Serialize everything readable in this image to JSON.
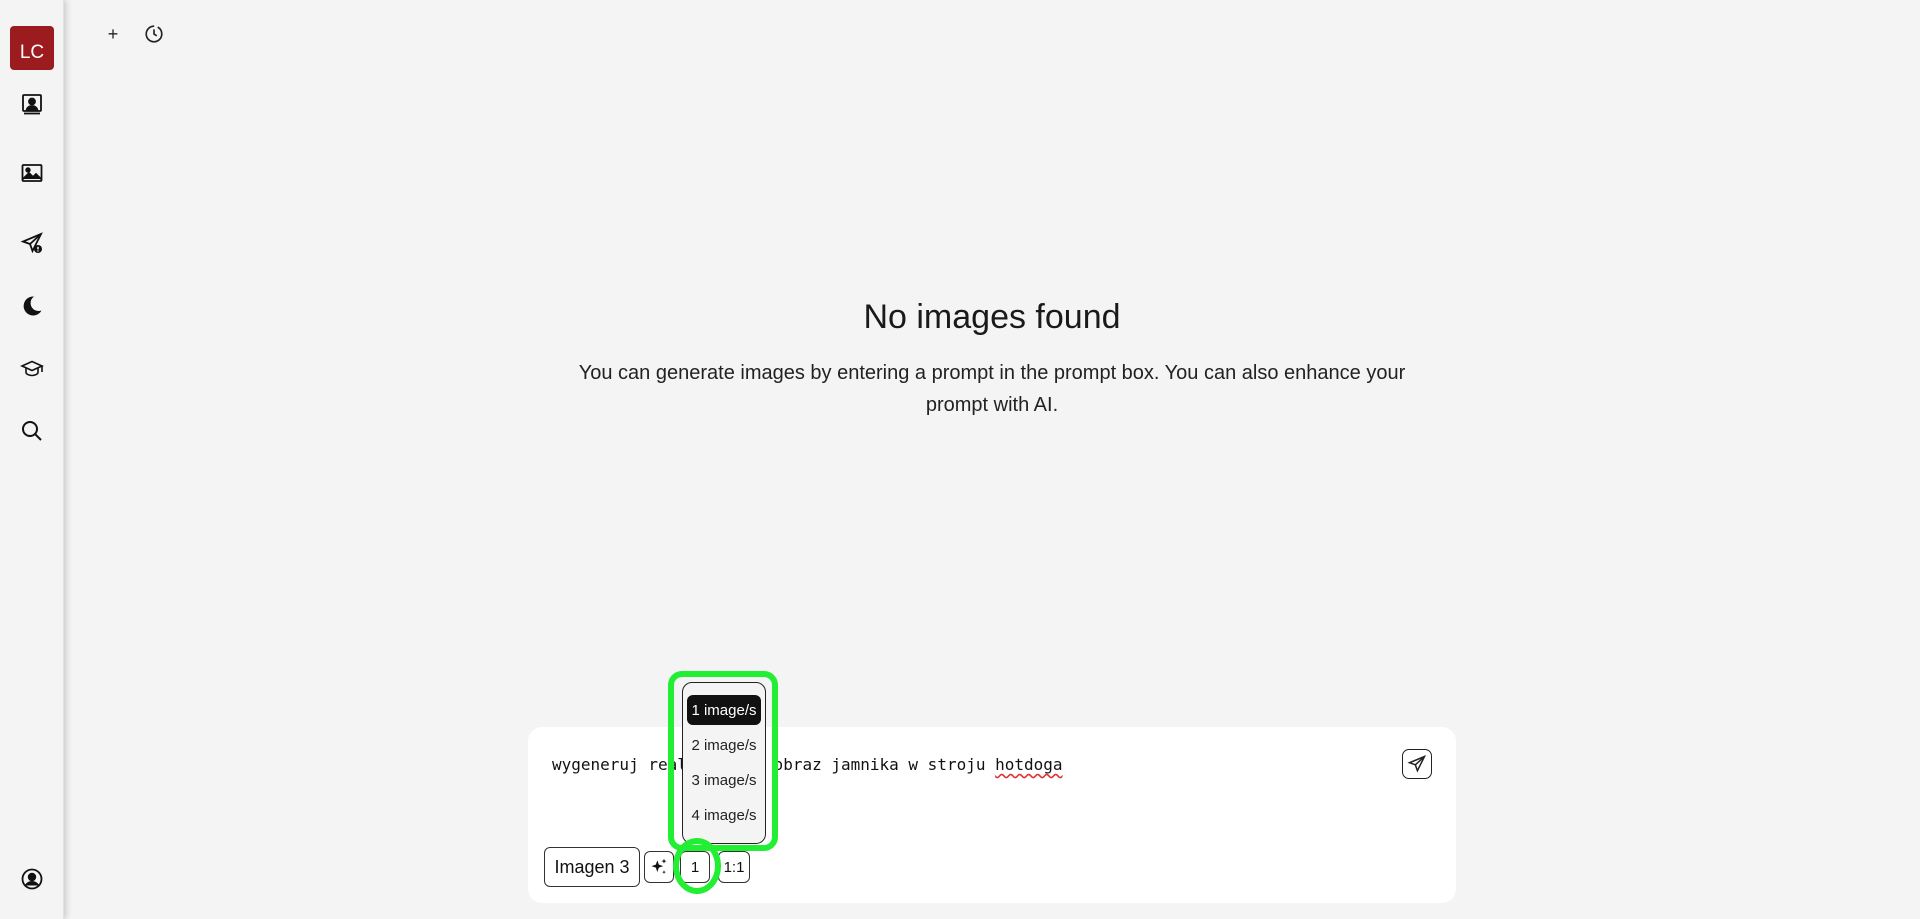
{
  "sidebar": {
    "avatar_initials": "LC",
    "avatar_color": "#9b1b1f",
    "items": [
      {
        "name": "portrait-icon"
      },
      {
        "name": "image-icon"
      },
      {
        "name": "send-alert-icon"
      },
      {
        "name": "moon-icon"
      },
      {
        "name": "graduation-cap-icon"
      },
      {
        "name": "search-icon"
      },
      {
        "name": "user-circle-icon"
      }
    ]
  },
  "toolbar": {
    "new_label": "+",
    "history_icon": "clock-icon"
  },
  "empty_state": {
    "title": "No images found",
    "description": "You can generate images by entering a prompt in the prompt box. You can also enhance your prompt with AI."
  },
  "prompt": {
    "text_before": "wygeneruj realistyczny obraz jamnika w stroju ",
    "text_misspelled": "hotdoga",
    "model_label": "Imagen 3",
    "count_label": "1",
    "ratio_label": "1:1"
  },
  "count_dropdown": {
    "options": [
      "1 image/s",
      "2 image/s",
      "3 image/s",
      "4 image/s"
    ],
    "selected": "1 image/s"
  },
  "highlight_color": "#22ee33"
}
